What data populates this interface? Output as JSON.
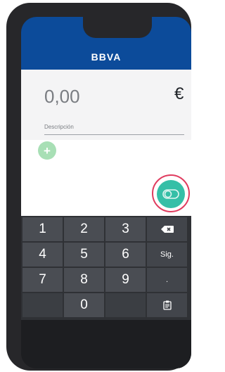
{
  "header": {
    "brand": "BBVA"
  },
  "amount": {
    "value": "0,00",
    "currency": "€"
  },
  "description": {
    "label": "Descripción"
  },
  "add_button": {
    "label": "+"
  },
  "keyboard": {
    "keys": [
      [
        "1",
        "2",
        "3",
        "⌫"
      ],
      [
        "4",
        "5",
        "6",
        "Sig."
      ],
      [
        "7",
        "8",
        "9",
        "."
      ],
      [
        "",
        "0",
        "",
        "📋"
      ]
    ]
  },
  "colors": {
    "brand_blue": "#0c4b9a",
    "fab": "#35bfa7",
    "highlight_ring": "#e03c5f",
    "add_button": "#a8dfb5"
  }
}
